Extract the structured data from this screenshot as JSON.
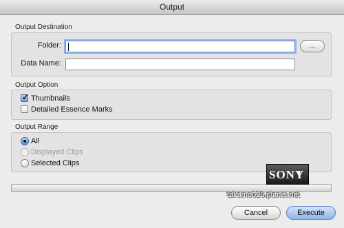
{
  "window": {
    "title": "Output"
  },
  "output_destination": {
    "title": "Output Destination",
    "folder_label": "Folder:",
    "folder_value": "",
    "browse_label": "...",
    "data_name_label": "Data Name:",
    "data_name_value": ""
  },
  "output_option": {
    "title": "Output Option",
    "thumbnails": {
      "label": "Thumbnails",
      "checked": true
    },
    "detailed_essence_marks": {
      "label": "Detailed Essence Marks",
      "checked": false
    }
  },
  "output_range": {
    "title": "Output Range",
    "options": [
      {
        "label": "All",
        "selected": true,
        "enabled": true
      },
      {
        "label": "Displayed Clips",
        "selected": false,
        "enabled": false
      },
      {
        "label": "Selected Clips",
        "selected": false,
        "enabled": true
      }
    ]
  },
  "progress": {
    "value": 0
  },
  "buttons": {
    "cancel": "Cancel",
    "execute": "Execute"
  },
  "logo": {
    "text": "SONY"
  },
  "watermark": {
    "text": "takamo625.planet.net"
  },
  "colors": {
    "focus_ring": "#8fb3ec",
    "default_button": "#8fb4ea"
  }
}
